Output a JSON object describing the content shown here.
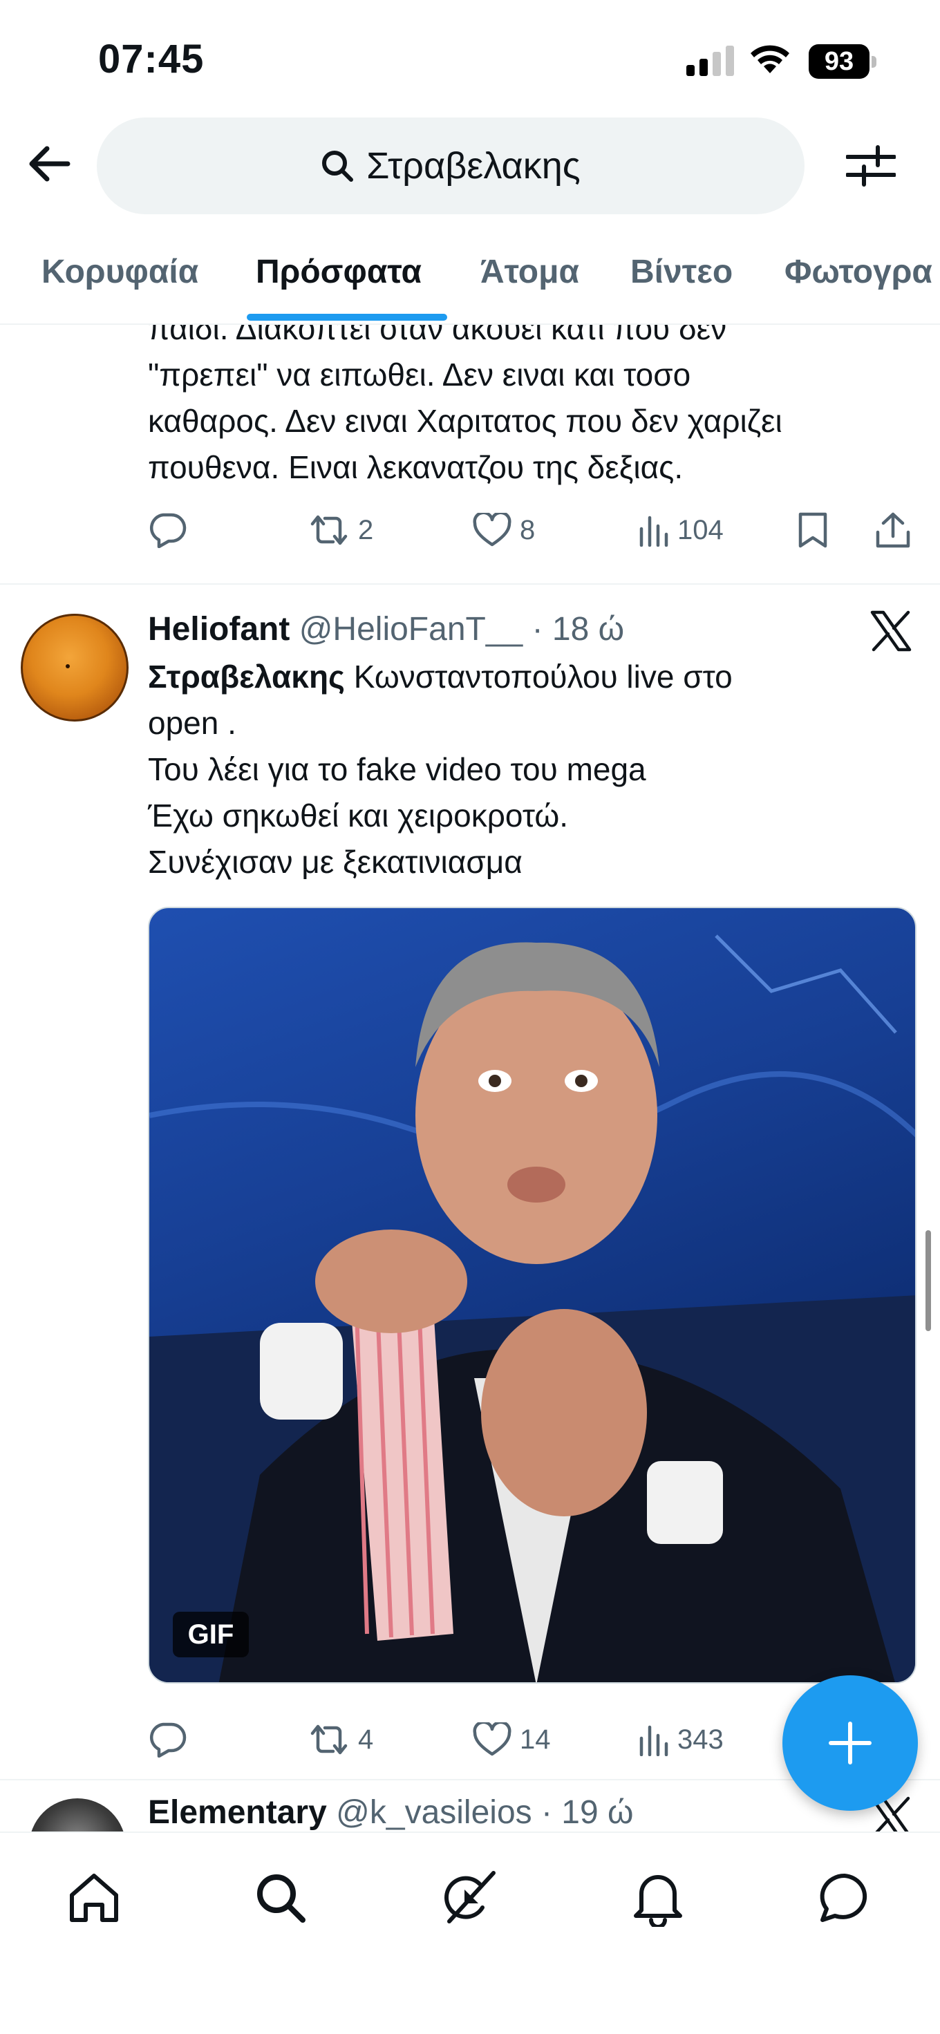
{
  "status_bar": {
    "time": "07:45",
    "battery": "93"
  },
  "header": {
    "search_query": "Στραβελακης"
  },
  "tabs": [
    {
      "label": "Κορυφαία",
      "active": false
    },
    {
      "label": "Πρόσφατα",
      "active": true
    },
    {
      "label": "Άτομα",
      "active": false
    },
    {
      "label": "Βίντεο",
      "active": false
    },
    {
      "label": "Φωτογρα",
      "active": false
    }
  ],
  "previous_tweet": {
    "text_lines": [
      "παιδι. Διακόπτει όταν ακούει κάτι που δεν",
      "\"πρεπει\" να ειπωθει. Δεν ειναι και τοσο",
      "καθαρος. Δεν ειναι Χαριτατος που δεν χαριζει",
      "πουθενα. Ειναι λεκανατζου της δεξιας."
    ],
    "retweets": "2",
    "likes": "8",
    "views": "104"
  },
  "tweet": {
    "author": "Heliofant",
    "handle": "@HelioFanT__",
    "time": "· 18 ώ",
    "highlight": "Στραβελακης",
    "line1_rest": " Κωνσταντοπούλου live στο",
    "lines": [
      "open .",
      "Του λέει για το fake video του mega",
      "Έχω σηκωθεί και χειροκροτώ.",
      "Συνέχισαν με ξεκατινιασμα"
    ],
    "media_badge": "GIF",
    "retweets": "4",
    "likes": "14",
    "views": "343"
  },
  "next_tweet": {
    "author": "Elementary",
    "handle": "@k_vasileios",
    "time": "· 19 ώ"
  },
  "colors": {
    "accent": "#1d9bf0",
    "text_primary": "#0f1419",
    "text_secondary": "#536471",
    "search_bg": "#eff3f4"
  },
  "icons": {
    "nav": [
      "home-icon",
      "search-icon",
      "grok-icon",
      "bell-icon",
      "messages-icon"
    ],
    "actions": [
      "reply-icon",
      "retweet-icon",
      "like-icon",
      "views-icon",
      "bookmark-icon",
      "share-icon"
    ]
  }
}
